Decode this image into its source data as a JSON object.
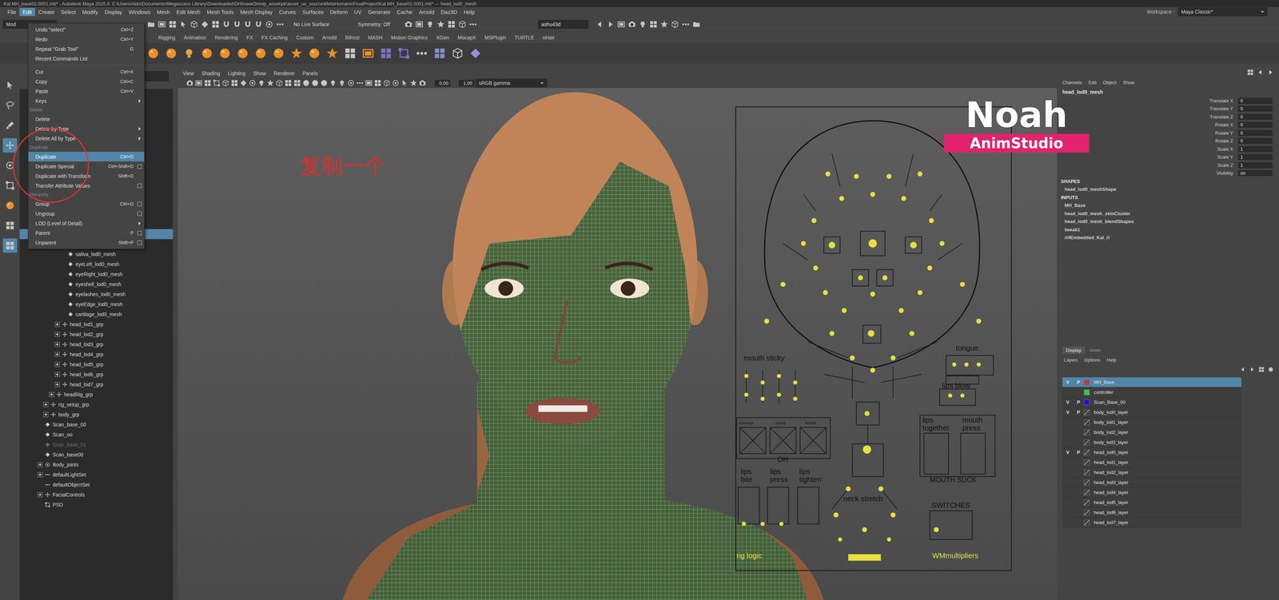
{
  "window": {
    "title": "Kal MH_base02.0001.mb* - Autodesk Maya 2020.4: C:\\Users\\Aido\\Documents\\Megascans Library\\Downloaded\\DHI\\newOmnip_asset\\pk\\asset_ue_source\\MetaHumans\\FinalProject\\Kal MH_base02.0001.mb* --- head_lod0_mesh"
  },
  "menubar": {
    "items": [
      {
        "label": "File",
        "selected": false
      },
      {
        "label": "Edit",
        "selected": true
      },
      {
        "label": "Create",
        "selected": false
      },
      {
        "label": "Select",
        "selected": false
      },
      {
        "label": "Modify",
        "selected": false
      },
      {
        "label": "Display",
        "selected": false
      },
      {
        "label": "Windows",
        "selected": false
      },
      {
        "label": "Mesh",
        "selected": false
      },
      {
        "label": "Edit Mesh",
        "selected": false
      },
      {
        "label": "Mesh Tools",
        "selected": false
      },
      {
        "label": "Mesh Display",
        "selected": false
      },
      {
        "label": "Curves",
        "selected": false
      },
      {
        "label": "Surfaces",
        "selected": false
      },
      {
        "label": "Deform",
        "selected": false
      },
      {
        "label": "UV",
        "selected": false
      },
      {
        "label": "Generate",
        "selected": false
      },
      {
        "label": "Cache",
        "selected": false
      },
      {
        "label": "Arnold",
        "selected": false
      },
      {
        "label": "Daz3D",
        "selected": false
      },
      {
        "label": "Help",
        "selected": false
      }
    ],
    "workspace_label": "Workspace :",
    "workspace": "Maya Classic*"
  },
  "status_line": {
    "mode": "Mod",
    "live_surface": "No Live Surface",
    "symmetry": "Symmetry: Off",
    "user": "ashu43d"
  },
  "shelf": {
    "tabs": [
      {
        "label": "Rigging",
        "selected": false
      },
      {
        "label": "Animation",
        "selected": false
      },
      {
        "label": "Rendering",
        "selected": false
      },
      {
        "label": "FX",
        "selected": false
      },
      {
        "label": "FX Caching",
        "selected": false
      },
      {
        "label": "Custom",
        "selected": false
      },
      {
        "label": "Arnold",
        "selected": false
      },
      {
        "label": "Bifrost",
        "selected": false
      },
      {
        "label": "MASH",
        "selected": false
      },
      {
        "label": "Motion Graphics",
        "selected": false
      },
      {
        "label": "XGen",
        "selected": false
      },
      {
        "label": "MocapX",
        "selected": false
      },
      {
        "label": "MSPlugin",
        "selected": false
      },
      {
        "label": "TURTLE",
        "selected": false
      },
      {
        "label": "nHair",
        "selected": false
      }
    ]
  },
  "edit_menu": {
    "items": [
      {
        "kind": "item",
        "label": "Undo \"select\"",
        "shortcut": "Ctrl+Z",
        "submenu": false,
        "option_box": false,
        "selected": false
      },
      {
        "kind": "item",
        "label": "Redo",
        "shortcut": "Ctrl+Y",
        "submenu": false,
        "option_box": false,
        "selected": false
      },
      {
        "kind": "item",
        "label": "Repeat \"Grab Tool\"",
        "shortcut": "G",
        "submenu": false,
        "option_box": false,
        "selected": false
      },
      {
        "kind": "item",
        "label": "Recent Commands List",
        "shortcut": "",
        "submenu": false,
        "option_box": false,
        "selected": false
      },
      {
        "kind": "separator",
        "label": "",
        "shortcut": "",
        "submenu": false,
        "option_box": false,
        "selected": false
      },
      {
        "kind": "item",
        "label": "Cut",
        "shortcut": "Ctrl+X",
        "submenu": false,
        "option_box": false,
        "selected": false
      },
      {
        "kind": "item",
        "label": "Copy",
        "shortcut": "Ctrl+C",
        "submenu": false,
        "option_box": false,
        "selected": false
      },
      {
        "kind": "item",
        "label": "Paste",
        "shortcut": "Ctrl+V",
        "submenu": false,
        "option_box": false,
        "selected": false
      },
      {
        "kind": "item",
        "label": "Keys",
        "shortcut": "",
        "submenu": true,
        "option_box": false,
        "selected": false
      },
      {
        "kind": "section",
        "label": "Delete",
        "shortcut": "",
        "submenu": false,
        "option_box": false,
        "selected": false
      },
      {
        "kind": "item",
        "label": "Delete",
        "shortcut": "",
        "submenu": false,
        "option_box": false,
        "selected": false
      },
      {
        "kind": "item",
        "label": "Delete by Type",
        "shortcut": "",
        "submenu": true,
        "option_box": false,
        "selected": false
      },
      {
        "kind": "item",
        "label": "Delete All by Type",
        "shortcut": "",
        "submenu": true,
        "option_box": false,
        "selected": false
      },
      {
        "kind": "section",
        "label": "Duplicate",
        "shortcut": "",
        "submenu": false,
        "option_box": false,
        "selected": false
      },
      {
        "kind": "item",
        "label": "Duplicate",
        "shortcut": "Ctrl+D",
        "submenu": false,
        "option_box": false,
        "selected": true
      },
      {
        "kind": "item",
        "label": "Duplicate Special",
        "shortcut": "Ctrl+Shift+D",
        "submenu": false,
        "option_box": true,
        "selected": false
      },
      {
        "kind": "item",
        "label": "Duplicate with Transform",
        "shortcut": "Shift+D",
        "submenu": false,
        "option_box": false,
        "selected": false
      },
      {
        "kind": "item",
        "label": "Transfer Attribute Values",
        "shortcut": "",
        "submenu": false,
        "option_box": true,
        "selected": false
      },
      {
        "kind": "section",
        "label": "Hierarchy",
        "shortcut": "",
        "submenu": false,
        "option_box": false,
        "selected": false
      },
      {
        "kind": "item",
        "label": "Group",
        "shortcut": "Ctrl+G",
        "submenu": false,
        "option_box": true,
        "selected": false
      },
      {
        "kind": "item",
        "label": "Ungroup",
        "shortcut": "",
        "submenu": false,
        "option_box": true,
        "selected": false
      },
      {
        "kind": "item",
        "label": "LOD (Level of Detail)",
        "shortcut": "",
        "submenu": true,
        "option_box": false,
        "selected": false
      },
      {
        "kind": "item",
        "label": "Parent",
        "shortcut": "P",
        "submenu": false,
        "option_box": true,
        "selected": false
      },
      {
        "kind": "item",
        "label": "Unparent",
        "shortcut": "Shift+P",
        "submenu": false,
        "option_box": true,
        "selected": false
      }
    ]
  },
  "annotation": {
    "text": "复制一个"
  },
  "outliner": {
    "covered_rows": [
      {
        "selected": false
      },
      {
        "selected": false
      },
      {
        "selected": false
      },
      {
        "selected": false
      },
      {
        "selected": false
      },
      {
        "selected": false
      },
      {
        "selected": false
      },
      {
        "selected": false
      },
      {
        "selected": false
      },
      {
        "selected": false
      },
      {
        "selected": false
      },
      {
        "selected": false
      },
      {
        "selected": false
      },
      {
        "selected": false
      },
      {
        "selected": true
      },
      {
        "selected": false
      }
    ],
    "rows": [
      {
        "label": "saliva_lod0_mesh",
        "depth": 4,
        "expandable": false,
        "kind": "mesh",
        "dimmed": false
      },
      {
        "label": "eyeLeft_lod0_mesh",
        "depth": 4,
        "expandable": false,
        "kind": "mesh",
        "dimmed": false
      },
      {
        "label": "eyeRight_lod0_mesh",
        "depth": 4,
        "expandable": false,
        "kind": "mesh",
        "dimmed": false
      },
      {
        "label": "eyeshell_lod0_mesh",
        "depth": 4,
        "expandable": false,
        "kind": "mesh",
        "dimmed": false
      },
      {
        "label": "eyelashes_lod0_mesh",
        "depth": 4,
        "expandable": false,
        "kind": "mesh",
        "dimmed": false
      },
      {
        "label": "eyeEdge_lod0_mesh",
        "depth": 4,
        "expandable": false,
        "kind": "mesh",
        "dimmed": false
      },
      {
        "label": "cartilage_lod0_mesh",
        "depth": 4,
        "expandable": false,
        "kind": "mesh",
        "dimmed": false
      },
      {
        "label": "head_lod1_grp",
        "depth": 3,
        "expandable": true,
        "kind": "group",
        "dimmed": false
      },
      {
        "label": "head_lod2_grp",
        "depth": 3,
        "expandable": true,
        "kind": "group",
        "dimmed": false
      },
      {
        "label": "head_lod3_grp",
        "depth": 3,
        "expandable": true,
        "kind": "group",
        "dimmed": false
      },
      {
        "label": "head_lod4_grp",
        "depth": 3,
        "expandable": true,
        "kind": "group",
        "dimmed": false
      },
      {
        "label": "head_lod5_grp",
        "depth": 3,
        "expandable": true,
        "kind": "group",
        "dimmed": false
      },
      {
        "label": "head_lod6_grp",
        "depth": 3,
        "expandable": true,
        "kind": "group",
        "dimmed": false
      },
      {
        "label": "head_lod7_grp",
        "depth": 3,
        "expandable": true,
        "kind": "group",
        "dimmed": false
      },
      {
        "label": "headRig_grp",
        "depth": 2,
        "expandable": true,
        "kind": "group",
        "dimmed": false
      },
      {
        "label": "rig_setup_grp",
        "depth": 1,
        "expandable": true,
        "kind": "group",
        "dimmed": false
      },
      {
        "label": "body_grp",
        "depth": 1,
        "expandable": true,
        "kind": "group",
        "dimmed": false
      },
      {
        "label": "Scan_base_00",
        "depth": 0,
        "expandable": false,
        "kind": "mesh",
        "dimmed": false
      },
      {
        "label": "Scan_oo",
        "depth": 0,
        "expandable": false,
        "kind": "mesh",
        "dimmed": false
      },
      {
        "label": "Scan_base_01",
        "depth": 0,
        "expandable": false,
        "kind": "mesh",
        "dimmed": true
      },
      {
        "label": "Scan_base00",
        "depth": 0,
        "expandable": false,
        "kind": "mesh",
        "dimmed": false
      },
      {
        "label": "Body_joints",
        "depth": 0,
        "expandable": true,
        "kind": "joint",
        "dimmed": false
      },
      {
        "label": "defaultLightSet",
        "depth": 0,
        "expandable": true,
        "kind": "set",
        "dimmed": false
      },
      {
        "label": "defaultObjectSet",
        "depth": 0,
        "expandable": false,
        "kind": "set",
        "dimmed": false
      },
      {
        "label": "FacialControls",
        "depth": 0,
        "expandable": true,
        "kind": "group",
        "dimmed": false
      },
      {
        "label": "PSD",
        "depth": 0,
        "expandable": false,
        "kind": "node",
        "dimmed": false
      }
    ]
  },
  "viewport": {
    "menu": [
      "View",
      "Shading",
      "Lighting",
      "Show",
      "Renderer",
      "Panels"
    ],
    "exposure": "0.00",
    "gamma": "1.00",
    "color_space": "sRGB gamma",
    "board_labels": [
      {
        "lines": [
          "mouth sticky"
        ],
        "color": "#111111"
      },
      {
        "lines": [
          "tongue"
        ],
        "color": "#111111"
      },
      {
        "lines": [
          "lips blow"
        ],
        "color": "#111111"
      },
      {
        "lines": [
          "towards"
        ],
        "color": "#111111"
      },
      {
        "lines": [
          "purse"
        ],
        "color": "#111111"
      },
      {
        "lines": [
          "funnel"
        ],
        "color": "#111111"
      },
      {
        "lines": [
          "OH"
        ],
        "color": "#111111"
      },
      {
        "lines": [
          "lips",
          "together"
        ],
        "color": "#111111"
      },
      {
        "lines": [
          "mouth",
          "press"
        ],
        "color": "#111111"
      },
      {
        "lines": [
          "MOUTH SUCK"
        ],
        "color": "#111111"
      },
      {
        "lines": [
          "lips",
          "bite"
        ],
        "color": "#111111"
      },
      {
        "lines": [
          "lips",
          "press"
        ],
        "color": "#111111"
      },
      {
        "lines": [
          "lips",
          "tighten"
        ],
        "color": "#111111"
      },
      {
        "lines": [
          "neck stretch"
        ],
        "color": "#111111"
      },
      {
        "lines": [
          "SWITCHES"
        ],
        "color": "#111111"
      },
      {
        "lines": [
          "rig logic"
        ],
        "color": "#e6dc3a"
      },
      {
        "lines": [
          "WMmultipliers"
        ],
        "color": "#d8e050"
      }
    ]
  },
  "watermark": {
    "name": "Noah",
    "studio": "AnimStudio"
  },
  "channel_box": {
    "menu": [
      "Channels",
      "Edit",
      "Object",
      "Show"
    ],
    "object": "head_lod0_mesh",
    "attributes": [
      {
        "name": "Translate X",
        "value": "0"
      },
      {
        "name": "Translate Y",
        "value": "0"
      },
      {
        "name": "Translate Z",
        "value": "0"
      },
      {
        "name": "Rotate X",
        "value": "0"
      },
      {
        "name": "Rotate Y",
        "value": "0"
      },
      {
        "name": "Rotate Z",
        "value": "0"
      },
      {
        "name": "Scale X",
        "value": "1"
      },
      {
        "name": "Scale Y",
        "value": "1"
      },
      {
        "name": "Scale Z",
        "value": "1"
      },
      {
        "name": "Visibility",
        "value": "on"
      }
    ],
    "shapes_heading": "SHAPES",
    "shapes": [
      "head_lod0_meshShape"
    ],
    "inputs_heading": "INPUTS",
    "inputs": [
      "MH_Base",
      "head_lod0_mesh_skinCluster",
      "head_lod0_mesh_blendShapes",
      "tweak1",
      "rl4Embedded_Kal_rl"
    ]
  },
  "layer_editor": {
    "tabs": [
      {
        "label": "Display",
        "selected": true
      },
      {
        "label": "Anim",
        "selected": false
      }
    ],
    "menu": [
      "Layers",
      "Options",
      "Help"
    ],
    "visible_mark": "V",
    "playback_mark": "P",
    "layers": [
      {
        "name": "MH_Base",
        "visible": true,
        "playback": true,
        "selected": true,
        "color": "#b23a4e"
      },
      {
        "name": "controller",
        "visible": false,
        "playback": false,
        "selected": false,
        "color": "#3fc43f"
      },
      {
        "name": "Scan_Base_00",
        "visible": true,
        "playback": true,
        "selected": false,
        "color": "#1414e6"
      },
      {
        "name": "body_lod0_layer",
        "visible": true,
        "playback": true,
        "selected": false,
        "color": ""
      },
      {
        "name": "body_lod1_layer",
        "visible": false,
        "playback": false,
        "selected": false,
        "color": ""
      },
      {
        "name": "body_lod2_layer",
        "visible": false,
        "playback": false,
        "selected": false,
        "color": ""
      },
      {
        "name": "body_lod3_layer",
        "visible": false,
        "playback": false,
        "selected": false,
        "color": ""
      },
      {
        "name": "head_lod0_layer",
        "visible": true,
        "playback": true,
        "selected": false,
        "color": ""
      },
      {
        "name": "head_lod1_layer",
        "visible": false,
        "playback": false,
        "selected": false,
        "color": ""
      },
      {
        "name": "head_lod2_layer",
        "visible": false,
        "playback": false,
        "selected": false,
        "color": ""
      },
      {
        "name": "head_lod3_layer",
        "visible": false,
        "playback": false,
        "selected": false,
        "color": ""
      },
      {
        "name": "head_lod4_layer",
        "visible": false,
        "playback": false,
        "selected": false,
        "color": ""
      },
      {
        "name": "head_lod5_layer",
        "visible": false,
        "playback": false,
        "selected": false,
        "color": ""
      },
      {
        "name": "head_lod6_layer",
        "visible": false,
        "playback": false,
        "selected": false,
        "color": ""
      },
      {
        "name": "head_lod7_layer",
        "visible": false,
        "playback": false,
        "selected": false,
        "color": ""
      }
    ]
  }
}
